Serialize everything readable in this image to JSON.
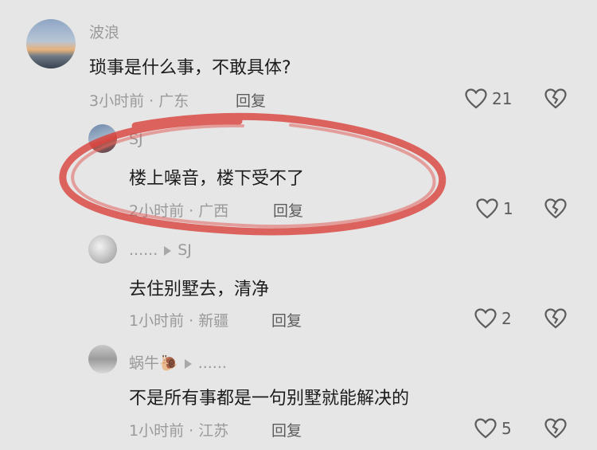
{
  "comments": [
    {
      "author": "波浪",
      "text": "琐事是什么事，不敢具体?",
      "meta": "3小时前 · 广东",
      "reply": "回复",
      "likes": "21"
    },
    {
      "author": "SJ",
      "text": "楼上噪音，楼下受不了",
      "meta": "2小时前 · 广西",
      "reply": "回复",
      "likes": "1"
    },
    {
      "author": "......",
      "reply_to": "SJ",
      "text": "去住别墅去，清净",
      "meta": "1小时前 · 新疆",
      "reply": "回复",
      "likes": "2"
    },
    {
      "author": "蜗牛",
      "author_emoji": "🐌",
      "reply_to": "......",
      "text": "不是所有事都是一句别墅就能解决的",
      "meta": "1小时前 · 江苏",
      "reply": "回复",
      "likes": "5"
    }
  ],
  "colors": {
    "background": "#e6e6e6",
    "annotation": "#d9443f"
  }
}
